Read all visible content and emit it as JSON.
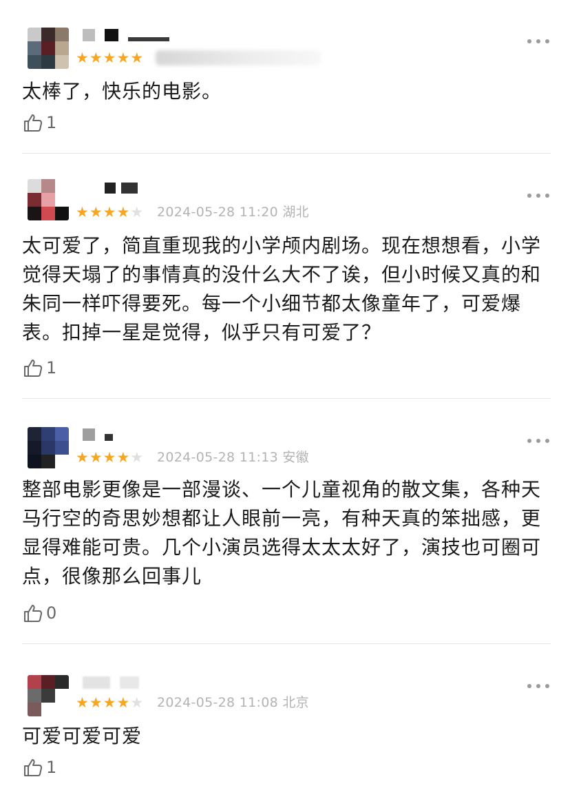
{
  "colors": {
    "star_filled": "#f5a623",
    "star_empty": "#e0e0e0",
    "meta_text": "#b3b3b3",
    "body_text": "#1a1a1a",
    "divider": "#e6e6e6"
  },
  "icons": {
    "like": "thumbs-up-icon",
    "more": "more-dots-icon",
    "star": "star-icon"
  },
  "reviews": [
    {
      "rating": 5,
      "date": "",
      "location": "",
      "text": "太棒了，快乐的电影。",
      "likes": "1"
    },
    {
      "rating": 4,
      "date": "2024-05-28 11:20",
      "location": "湖北",
      "text": "太可爱了，简直重现我的小学颅内剧场。现在想想看，小学觉得天塌了的事情真的没什么大不了诶，但小时候又真的和朱同一样吓得要死。每一个小细节都太像童年了，可爱爆表。扣掉一星是觉得，似乎只有可爱了？",
      "likes": "1"
    },
    {
      "rating": 4,
      "date": "2024-05-28 11:13",
      "location": "安徽",
      "text": "整部电影更像是一部漫谈、一个儿童视角的散文集，各种天马行空的奇思妙想都让人眼前一亮，有种天真的笨拙感，更显得难能可贵。几个小演员选得太太太好了，演技也可圈可点，很像那么回事儿",
      "likes": "0"
    },
    {
      "rating": 4,
      "date": "2024-05-28 11:08",
      "location": "北京",
      "text": "可爱可爱可爱",
      "likes": "1"
    }
  ]
}
